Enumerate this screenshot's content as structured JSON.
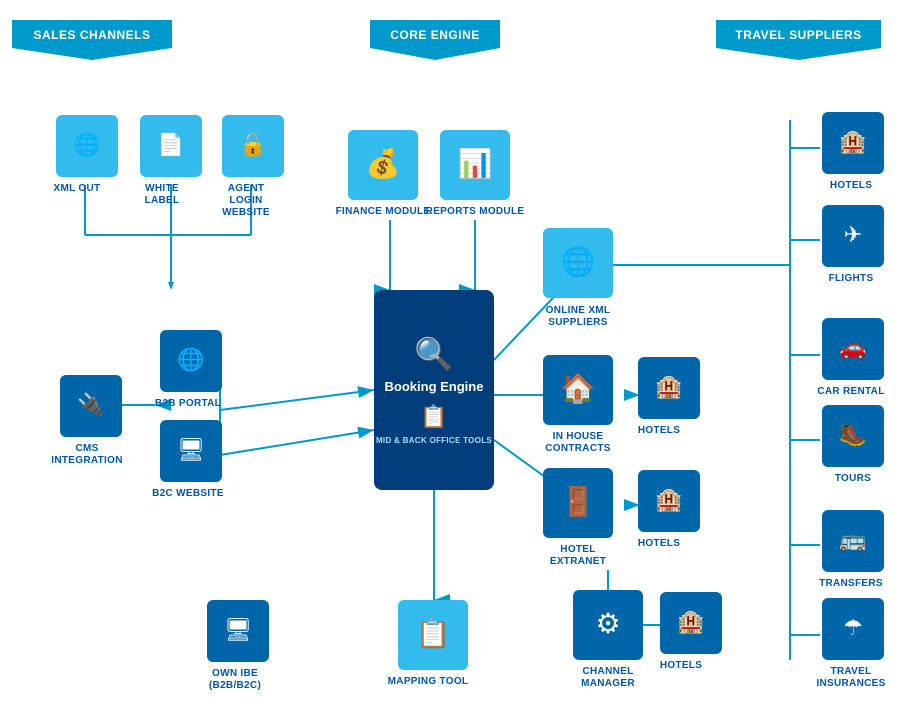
{
  "banners": {
    "sales_channels": "SALES CHANNELS",
    "core_engine": "CORE ENGINE",
    "travel_suppliers": "TRAVEL SUPPLIERS"
  },
  "sales_channel_items": [
    {
      "id": "xml-out",
      "label": "XML OUT",
      "icon": "🌐"
    },
    {
      "id": "white-label",
      "label": "WHITE LABEL",
      "icon": "📄"
    },
    {
      "id": "agent-login",
      "label": "AGENT LOGIN\nWEBSITE",
      "icon": "🔓"
    },
    {
      "id": "b2b-portal",
      "label": "B2B PORTAL",
      "icon": "🌐"
    },
    {
      "id": "b2c-website",
      "label": "B2C WEBSITE",
      "icon": "🖥"
    },
    {
      "id": "cms-integration",
      "label": "CMS\nINTEGRATION",
      "icon": "🔌"
    },
    {
      "id": "own-ibe",
      "label": "OWN IBE\n(B2B/B2C)",
      "icon": "🖥"
    }
  ],
  "core_engine_items": [
    {
      "id": "finance-module",
      "label": "FINANCE MODULE",
      "icon": "💰"
    },
    {
      "id": "reports-module",
      "label": "REPORTS MODULE",
      "icon": "📊"
    },
    {
      "id": "booking-engine",
      "label": "Booking Engine",
      "subtitle": "MID & BACK OFFICE TOOLS"
    },
    {
      "id": "mapping-tool",
      "label": "MAPPING TOOL",
      "icon": "📋"
    }
  ],
  "middle_items": [
    {
      "id": "online-xml",
      "label": "ONLINE XML\nSUPPLIERS",
      "icon": "🌐"
    },
    {
      "id": "in-house-contracts",
      "label": "IN HOUSE\nCONTRACTS",
      "icon": "🏠"
    },
    {
      "id": "hotel-extranet",
      "label": "HOTEL\nEXTRANET",
      "icon": "🚪"
    },
    {
      "id": "channel-manager",
      "label": "CHANNEL\nMANAGER",
      "icon": "⚙"
    }
  ],
  "hotels_boxes": [
    {
      "id": "hotels-1",
      "label": "HOTELS"
    },
    {
      "id": "hotels-2",
      "label": "HOTELS"
    },
    {
      "id": "hotels-3",
      "label": "HOTELS"
    },
    {
      "id": "hotels-4",
      "label": "HOTELS"
    }
  ],
  "travel_supplier_items": [
    {
      "id": "hotels-ts",
      "label": "HOTELS",
      "icon": "🏨"
    },
    {
      "id": "flights-ts",
      "label": "FLIGHTS",
      "icon": "✈"
    },
    {
      "id": "car-rental-ts",
      "label": "CAR RENTAL",
      "icon": "🚗"
    },
    {
      "id": "tours-ts",
      "label": "TOURS",
      "icon": "🥾"
    },
    {
      "id": "transfers-ts",
      "label": "TRANSFERS",
      "icon": "🚌"
    },
    {
      "id": "travel-insurances-ts",
      "label": "TRAVEL\nINSURANCES",
      "icon": "☂"
    }
  ]
}
